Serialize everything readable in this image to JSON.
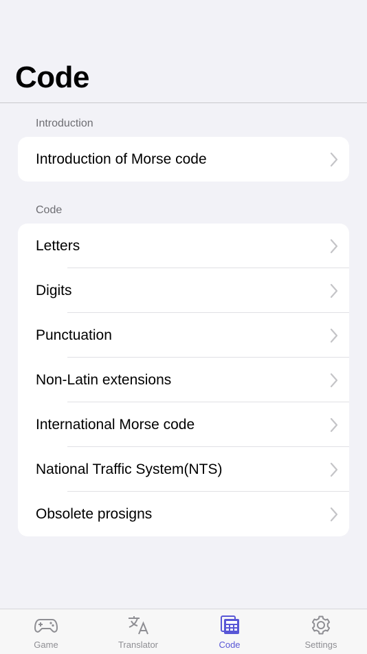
{
  "page": {
    "title": "Code"
  },
  "sections": [
    {
      "header": "Introduction",
      "items": [
        "Introduction of Morse code"
      ]
    },
    {
      "header": "Code",
      "items": [
        "Letters",
        "Digits",
        "Punctuation",
        "Non-Latin extensions",
        "International Morse code",
        "National Traffic System(NTS)",
        "Obsolete prosigns"
      ]
    }
  ],
  "tabbar": {
    "tabs": [
      {
        "label": "Game",
        "icon": "gamepad-icon",
        "active": false
      },
      {
        "label": "Translator",
        "icon": "translate-icon",
        "active": false
      },
      {
        "label": "Code",
        "icon": "code-table-icon",
        "active": true
      },
      {
        "label": "Settings",
        "icon": "gear-icon",
        "active": false
      }
    ]
  },
  "colors": {
    "accent": "#5856d6",
    "inactive": "#8e8e93",
    "background": "#f2f2f7"
  }
}
